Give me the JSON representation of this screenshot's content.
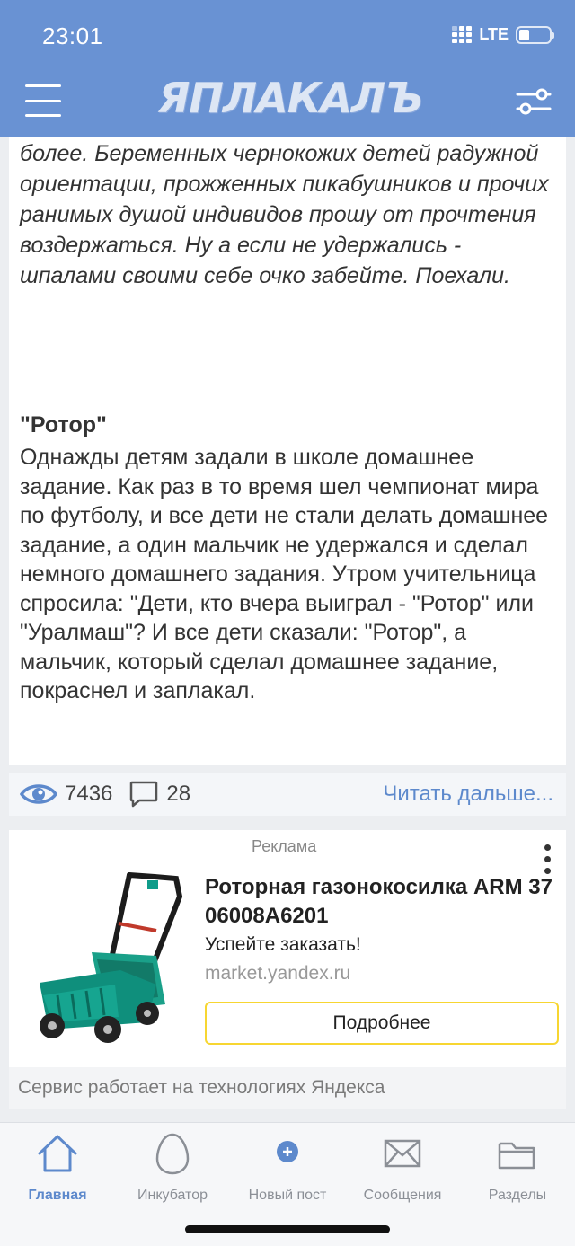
{
  "status_bar": {
    "time": "23:01",
    "network": "LTE",
    "battery_level": 0.35
  },
  "header": {
    "logo": "ЯПЛАКАЛЪ",
    "menu_icon": "hamburger-icon",
    "filter_icon": "sliders-icon",
    "color": "#6992d3"
  },
  "article": {
    "intro": "более. Беременных чернокожих детей радужной ориентации, прожженных пикабушников и прочих ранимых душой индивидов прошу от прочтения воздержаться. Ну а если не удержались - шпалами своими себе очко забейте. Поехали.",
    "story_title": "\"Ротор\"",
    "story_body": "Однажды детям задали в школе домашнее задание. Как раз в то время шел чемпионат мира по футболу, и все дети не стали делать домашнее задание, а один мальчик не удержался и сделал немного домашнего задания. Утром учительница спросила: \"Дети, кто вчера выиграл - \"Ротор\" или \"Уралмаш\"? И все дети сказали: \"Ротор\", а мальчик, который сделал домашнее задание, покраснел и заплакал.",
    "views": "7436",
    "comments": "28",
    "read_more": "Читать дальше..."
  },
  "ad": {
    "label": "Реклама",
    "title": "Роторная газонокосилка ARM 37 06008A6201",
    "subtitle": "Успейте заказать!",
    "domain": "market.yandex.ru",
    "button": "Подробнее",
    "footer": "Сервис работает на технологиях Яндекса",
    "accent": "#f7d631"
  },
  "tabbar": {
    "items": [
      {
        "label": "Главная",
        "icon": "home-icon",
        "active": true
      },
      {
        "label": "Инкубатор",
        "icon": "egg-icon",
        "active": false
      },
      {
        "label": "Новый пост",
        "icon": "plus-circle-icon",
        "active": false
      },
      {
        "label": "Сообщения",
        "icon": "envelope-icon",
        "active": false
      },
      {
        "label": "Разделы",
        "icon": "folder-icon",
        "active": false
      }
    ],
    "active_color": "#5d89cc"
  }
}
